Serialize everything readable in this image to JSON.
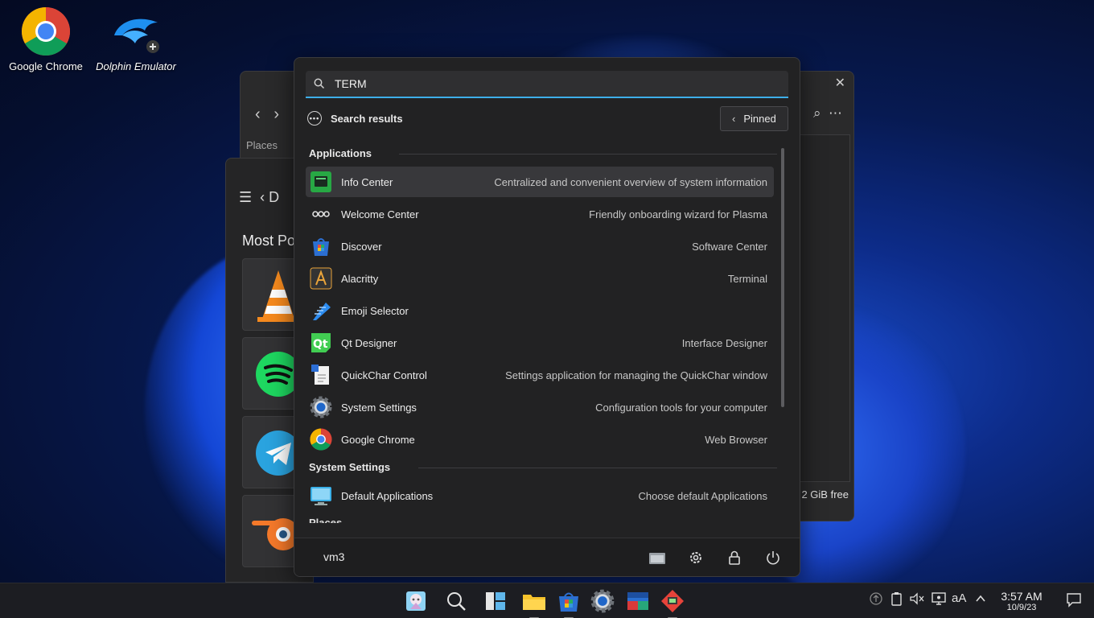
{
  "desktop": {
    "icons": [
      {
        "label": "Google Chrome"
      },
      {
        "label": "Dolphin Emulator"
      }
    ]
  },
  "background_window": {
    "places_label": "Places",
    "free_space": "2 GiB free",
    "section_title": "Most Po",
    "header_letter": "D"
  },
  "launcher": {
    "search_value": "TERM",
    "results_label": "Search results",
    "pinned_label": "Pinned",
    "sections": {
      "applications": "Applications",
      "system_settings": "System Settings",
      "places": "Places"
    },
    "apps": [
      {
        "name": "Info Center",
        "desc": "Centralized and convenient overview of system information"
      },
      {
        "name": "Welcome Center",
        "desc": "Friendly onboarding wizard for Plasma"
      },
      {
        "name": "Discover",
        "desc": "Software Center"
      },
      {
        "name": "Alacritty",
        "desc": "Terminal"
      },
      {
        "name": "Emoji Selector",
        "desc": ""
      },
      {
        "name": "Qt Designer",
        "desc": "Interface Designer"
      },
      {
        "name": "QuickChar Control",
        "desc": "Settings application for managing the QuickChar window"
      },
      {
        "name": "System Settings",
        "desc": "Configuration tools for your computer"
      },
      {
        "name": "Google Chrome",
        "desc": "Web Browser"
      }
    ],
    "settings": [
      {
        "name": "Default Applications",
        "desc": "Choose default Applications"
      }
    ],
    "footer": {
      "user": "vm3"
    }
  },
  "taskbar": {
    "clock_time": "3:57 AM",
    "clock_date": "10/9/23",
    "tray_text": "aA"
  },
  "colors": {
    "accent": "#3daee9",
    "launcher_bg": "#222223",
    "taskbar_bg": "#1c1d22"
  }
}
